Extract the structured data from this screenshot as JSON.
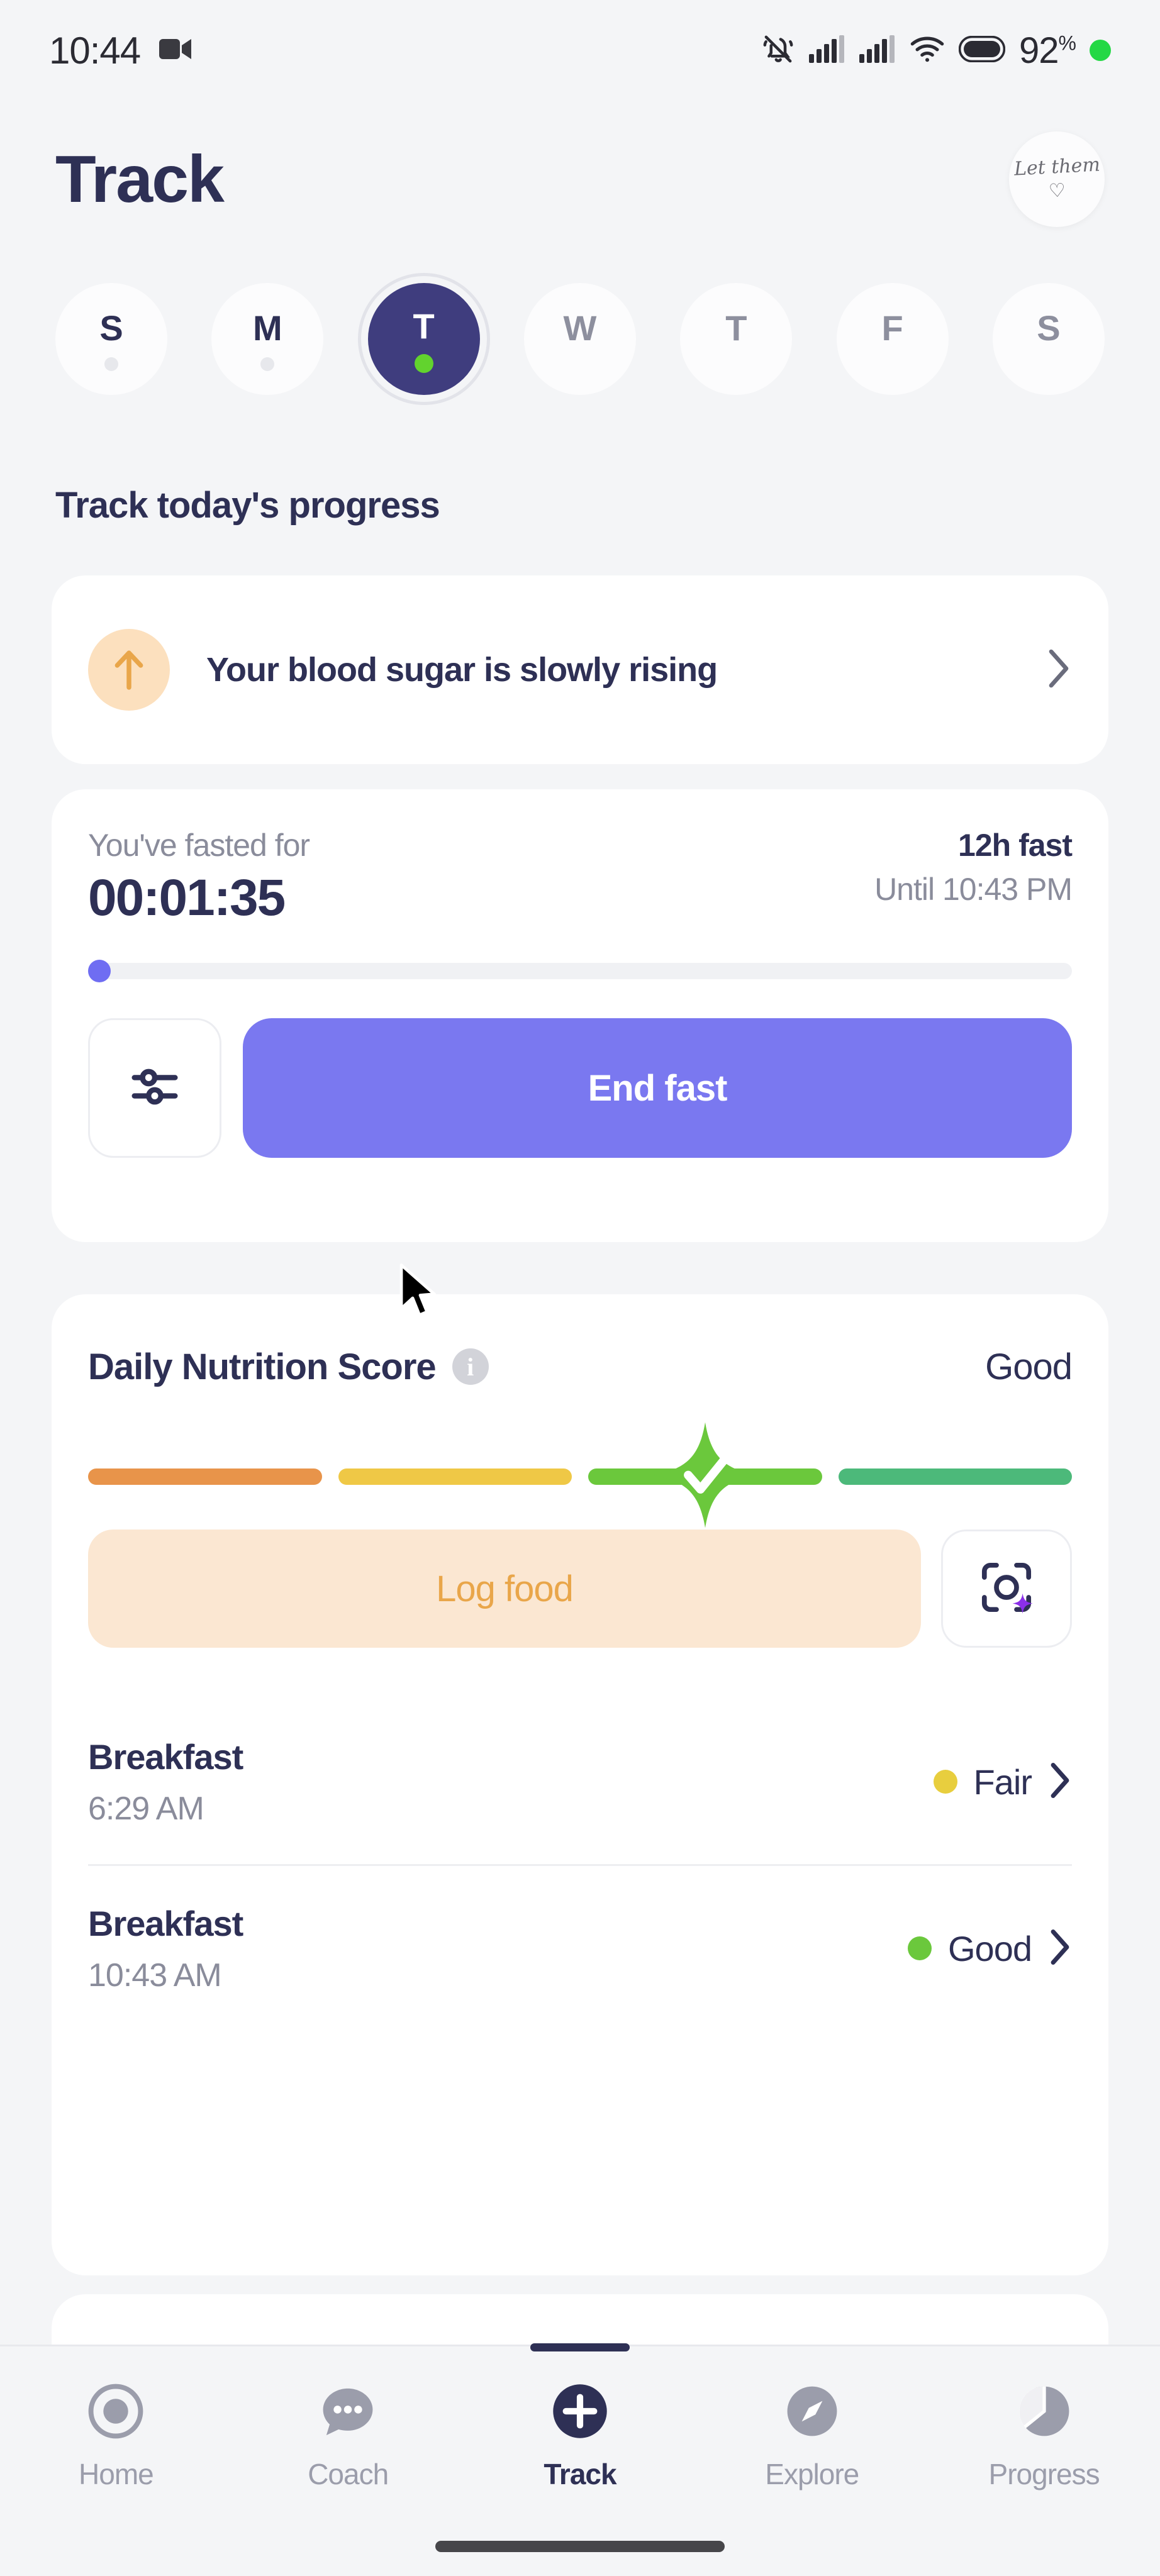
{
  "status_bar": {
    "time": "10:44",
    "recording_icon": "video-camera-icon",
    "icons": [
      "bell-muted-icon",
      "signal-bars-icon",
      "signal-bars-icon",
      "wifi-icon",
      "battery-icon"
    ],
    "battery_percent": "92",
    "battery_percent_symbol": "%",
    "recording_dot_color": "#24D845"
  },
  "header": {
    "title": "Track",
    "avatar": {
      "script_text": "Let them",
      "heart_glyph": "♡"
    }
  },
  "day_strip": {
    "days": [
      {
        "label": "S",
        "state": "past",
        "has_dot": true
      },
      {
        "label": "M",
        "state": "past",
        "has_dot": true
      },
      {
        "label": "T",
        "state": "selected",
        "has_dot": true
      },
      {
        "label": "W",
        "state": "future",
        "has_dot": false
      },
      {
        "label": "T",
        "state": "future",
        "has_dot": false
      },
      {
        "label": "F",
        "state": "future",
        "has_dot": false
      },
      {
        "label": "S",
        "state": "future",
        "has_dot": false
      }
    ],
    "selected_bg": "#3F3D7E",
    "selected_dot_color": "#62D32E"
  },
  "section_heading": "Track today's progress",
  "blood_sugar_card": {
    "icon": "arrow-up-icon",
    "icon_bg": "#FCE0BE",
    "icon_color": "#E9A64A",
    "message": "Your blood sugar is slowly rising",
    "chevron": "chevron-right-icon"
  },
  "fasting_card": {
    "fasted_label": "You've fasted for",
    "elapsed": "00:01:35",
    "plan_label": "12h fast",
    "until_label": "Until 10:43 PM",
    "progress_percent": 0.2,
    "progress_color": "#6F6DF2",
    "settings_button": {
      "icon": "sliders-icon",
      "label": ""
    },
    "end_fast_button": {
      "label": "End fast",
      "color": "#7A78F0"
    }
  },
  "nutrition_card": {
    "title": "Daily Nutrition Score",
    "info_icon": "info-icon",
    "info_glyph": "i",
    "verdict": "Good",
    "score_segments": [
      {
        "name": "poor",
        "color": "#E8944A",
        "active": false
      },
      {
        "name": "fair",
        "color": "#EFC846",
        "active": false
      },
      {
        "name": "good",
        "color": "#6BC83C",
        "active": true
      },
      {
        "name": "excellent",
        "color": "#4CB97A",
        "active": false
      }
    ],
    "active_check_glyph": "✓",
    "log_food_button": {
      "label": "Log food",
      "bg": "#FBE7D2",
      "text_color": "#E9A64A"
    },
    "scan_button": {
      "icon": "camera-scan-ai-icon",
      "sparkle_color": "#8B2FE8"
    },
    "meals": [
      {
        "name": "Breakfast",
        "time": "6:29 AM",
        "verdict": "Fair",
        "dot_color": "#E8CE3E"
      },
      {
        "name": "Breakfast",
        "time": "10:43 AM",
        "verdict": "Good",
        "dot_color": "#6BC83C"
      }
    ]
  },
  "bottom_nav": {
    "items": [
      {
        "label": "Home",
        "icon": "target-circle-icon",
        "active": false
      },
      {
        "label": "Coach",
        "icon": "chat-bubble-icon",
        "active": false
      },
      {
        "label": "Track",
        "icon": "plus-circle-icon",
        "active": true
      },
      {
        "label": "Explore",
        "icon": "compass-icon",
        "active": false
      },
      {
        "label": "Progress",
        "icon": "pie-chart-icon",
        "active": false
      }
    ],
    "active_color": "#2E3055",
    "inactive_color": "#9B9DAB"
  }
}
